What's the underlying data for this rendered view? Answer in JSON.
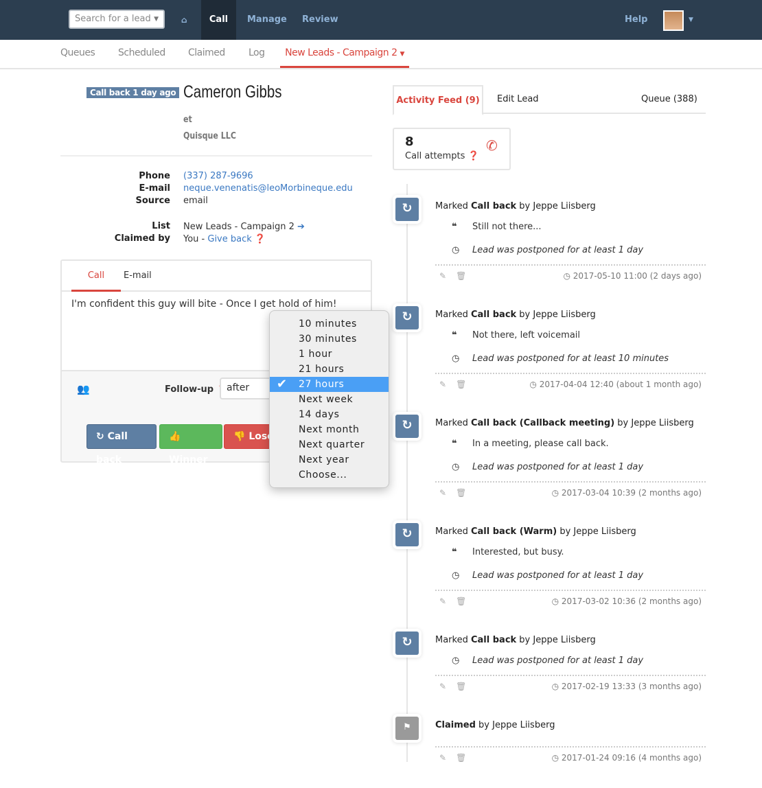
{
  "nav": {
    "search_placeholder": "Search for a lead",
    "items": [
      "Call",
      "Manage",
      "Review"
    ],
    "help": "Help",
    "home_icon": "home-icon"
  },
  "subnav": {
    "items": [
      "Queues",
      "Scheduled",
      "Claimed",
      "Log"
    ],
    "active": "New Leads - Campaign 2"
  },
  "lead": {
    "badge": "Call back 1 day ago",
    "name": "Cameron Gibbs",
    "title": "et",
    "company": "Quisque LLC",
    "labels": {
      "phone": "Phone",
      "email": "E-mail",
      "source": "Source",
      "list": "List",
      "claimed": "Claimed by"
    },
    "phone": "(337) 287-9696",
    "email": "neque.venenatis@leoMorbineque.edu",
    "source": "email",
    "list": "New Leads - Campaign 2",
    "claimed_you": "You - ",
    "give_back": "Give back"
  },
  "panel": {
    "tabs": [
      "Call",
      "E-mail"
    ],
    "note": "I'm confident this guy will bite - Once I get hold of him!",
    "followup_label": "Follow-up",
    "followup_value": "after",
    "buttons": {
      "callback": "Call back",
      "winner": "Winner",
      "loser": "Loser"
    }
  },
  "dropdown": {
    "options": [
      "10 minutes",
      "30 minutes",
      "1 hour",
      "21 hours",
      "27 hours",
      "Next week",
      "14 days",
      "Next month",
      "Next quarter",
      "Next year",
      "Choose..."
    ],
    "selected": "27 hours"
  },
  "right_tabs": {
    "feed": "Activity Feed (9)",
    "edit": "Edit Lead",
    "queue": "Queue (388)"
  },
  "stats": {
    "count": "8",
    "label": "Call attempts"
  },
  "colors": {
    "navbar": "#2c3e50",
    "accent": "#d9453d",
    "callback": "#5e7fa3",
    "winner": "#5cb85c",
    "loser": "#d9534f",
    "selected": "#4a9ff5"
  },
  "timeline": [
    {
      "pre": "Marked ",
      "bold": "Call back",
      "post": " by Jeppe Liisberg",
      "quote": "Still not there...",
      "postpone": "Lead was postponed for at least 1 day",
      "ts": "2017-05-10 11:00 (2 days ago)"
    },
    {
      "pre": "Marked ",
      "bold": "Call back",
      "post": " by Jeppe Liisberg",
      "quote": "Not there, left voicemail",
      "postpone": "Lead was postponed for at least 10 minutes",
      "ts": "2017-04-04 12:40 (about 1 month ago)"
    },
    {
      "pre": "Marked ",
      "bold": "Call back (Callback meeting)",
      "post": " by Jeppe Liisberg",
      "quote": "In a meeting, please call back.",
      "postpone": "Lead was postponed for at least 1 day",
      "ts": "2017-03-04 10:39 (2 months ago)"
    },
    {
      "pre": "Marked ",
      "bold": "Call back (Warm)",
      "post": " by Jeppe Liisberg",
      "quote": "Interested, but busy.",
      "postpone": "Lead was postponed for at least 1 day",
      "ts": "2017-03-02 10:36 (2 months ago)"
    },
    {
      "pre": "Marked ",
      "bold": "Call back",
      "post": " by Jeppe Liisberg",
      "postpone": "Lead was postponed for at least 1 day",
      "ts": "2017-02-19 13:33 (3 months ago)"
    },
    {
      "pre": "",
      "bold": "Claimed",
      "post": " by Jeppe Liisberg",
      "ts": "2017-01-24 09:16 (4 months ago)",
      "type": "claimed"
    }
  ]
}
